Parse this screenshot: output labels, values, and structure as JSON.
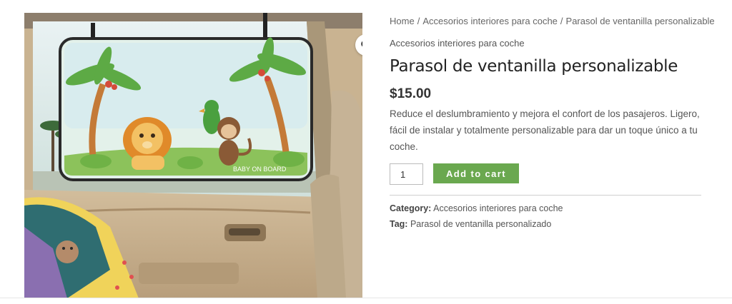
{
  "product_image": {
    "badge_text": "BABY ON BOARD"
  },
  "zoom_icon": "magnifier-icon",
  "breadcrumb": {
    "items": [
      "Home",
      "Accesorios interiores para coche",
      "Parasol de ventanilla personalizable"
    ],
    "separator": "/"
  },
  "product": {
    "category_label": "Accesorios interiores para coche",
    "title": "Parasol de ventanilla personalizable",
    "price": "$15.00",
    "description": "Reduce el deslumbramiento y mejora el confort de los pasajeros. Ligero, fácil de instalar y totalmente personalizable para dar un toque único a tu coche.",
    "quantity": "1",
    "add_to_cart_label": "Add to cart",
    "accent_color": "#6aa84f"
  },
  "meta": {
    "category_label": "Category:",
    "category_value": "Accesorios interiores para coche",
    "tag_label": "Tag:",
    "tag_value": "Parasol de ventanilla personalizado"
  }
}
